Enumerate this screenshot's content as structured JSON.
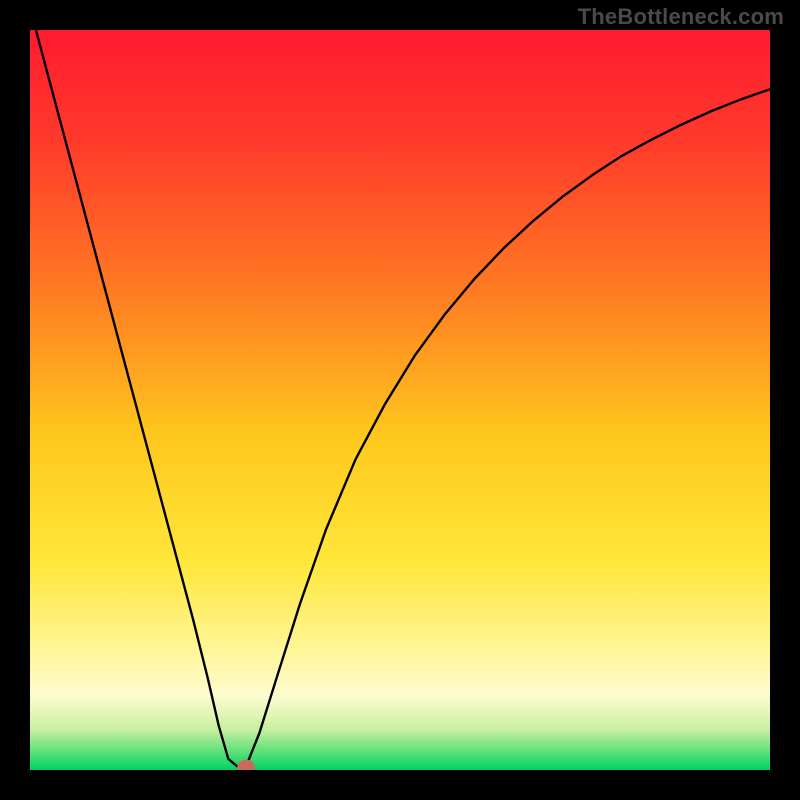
{
  "watermark": "TheBottleneck.com",
  "chart_data": {
    "type": "line",
    "title": "",
    "xlabel": "",
    "ylabel": "",
    "xlim": [
      0,
      1
    ],
    "ylim": [
      0,
      1
    ],
    "gradient_stops": [
      {
        "offset": 0.0,
        "color": "#ff1a30"
      },
      {
        "offset": 0.15,
        "color": "#ff3a2b"
      },
      {
        "offset": 0.35,
        "color": "#ff7a22"
      },
      {
        "offset": 0.55,
        "color": "#ffc81e"
      },
      {
        "offset": 0.72,
        "color": "#ffe73a"
      },
      {
        "offset": 0.84,
        "color": "#fff69a"
      },
      {
        "offset": 0.9,
        "color": "#fdfccf"
      },
      {
        "offset": 0.945,
        "color": "#c9f0a0"
      },
      {
        "offset": 0.975,
        "color": "#5fe07a"
      },
      {
        "offset": 1.0,
        "color": "#00d465"
      }
    ],
    "series": [
      {
        "name": "curve",
        "x": [
          0.0,
          0.02,
          0.04,
          0.06,
          0.08,
          0.1,
          0.12,
          0.14,
          0.16,
          0.18,
          0.2,
          0.22,
          0.24,
          0.255,
          0.268,
          0.28,
          0.292,
          0.31,
          0.335,
          0.365,
          0.4,
          0.44,
          0.48,
          0.52,
          0.56,
          0.6,
          0.64,
          0.68,
          0.72,
          0.76,
          0.8,
          0.84,
          0.88,
          0.92,
          0.96,
          1.0
        ],
        "y": [
          1.03,
          0.955,
          0.88,
          0.805,
          0.73,
          0.655,
          0.58,
          0.505,
          0.43,
          0.355,
          0.28,
          0.205,
          0.125,
          0.06,
          0.015,
          0.005,
          0.005,
          0.05,
          0.13,
          0.225,
          0.325,
          0.42,
          0.495,
          0.56,
          0.615,
          0.663,
          0.705,
          0.742,
          0.775,
          0.804,
          0.83,
          0.852,
          0.872,
          0.89,
          0.906,
          0.92
        ]
      }
    ],
    "marker": {
      "cx": 0.292,
      "cy": 0.004,
      "rx": 0.012,
      "ry": 0.01,
      "fill": "#c96a5a"
    }
  }
}
